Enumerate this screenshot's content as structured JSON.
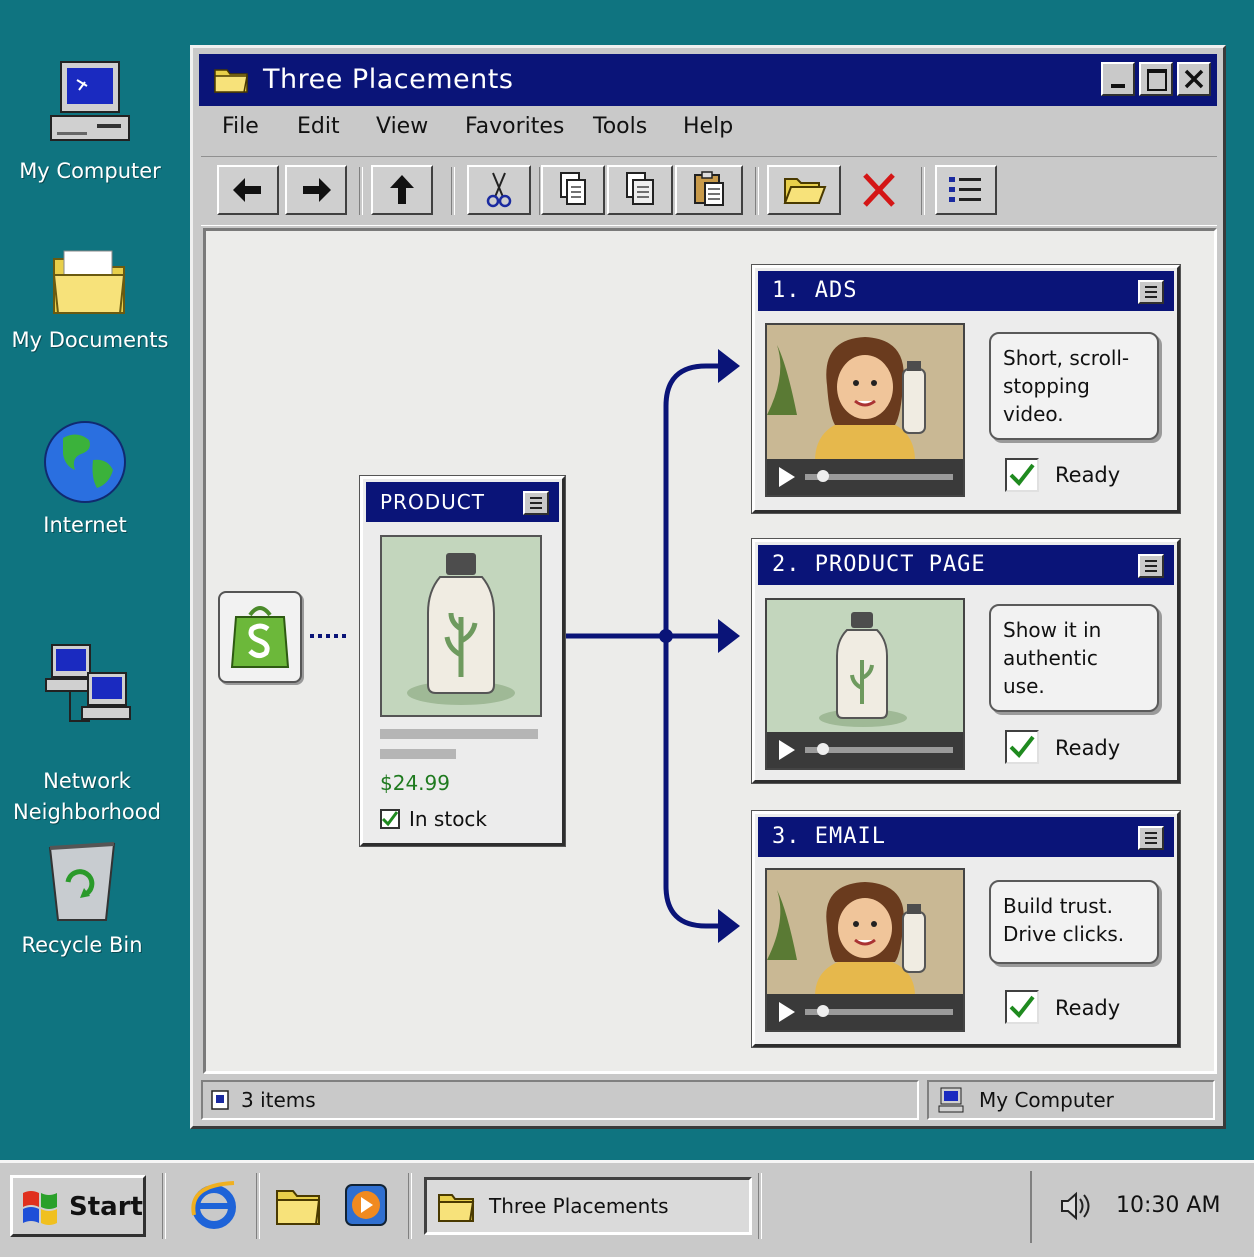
{
  "desktop": {
    "icons": [
      {
        "label": "My Computer"
      },
      {
        "label": "My Documents"
      },
      {
        "label": "Internet"
      },
      {
        "label": "Network\nNeighborhood"
      },
      {
        "label": "Recycle Bin"
      }
    ]
  },
  "window": {
    "title": "Three Placements",
    "menu": [
      "File",
      "Edit",
      "View",
      "Favorites",
      "Tools",
      "Help"
    ],
    "toolbar": [
      "back-icon",
      "forward-icon",
      "up-icon",
      "cut-icon",
      "copy-icon",
      "copy-to-icon",
      "paste-icon",
      "open-folder-icon",
      "delete-icon",
      "details-view-icon"
    ]
  },
  "product": {
    "header": "PRODUCT",
    "price": "$24.99",
    "stock": "In stock",
    "in_stock": true
  },
  "placements": [
    {
      "title": "1. ADS",
      "caption": "Short, scroll-stopping video.",
      "status": "Ready",
      "checked": true
    },
    {
      "title": "2. PRODUCT PAGE",
      "caption": "Show it in authentic use.",
      "status": "Ready",
      "checked": true
    },
    {
      "title": "3. EMAIL",
      "caption": "Build trust. Drive clicks.",
      "status": "Ready",
      "checked": true
    }
  ],
  "statusbar": {
    "items": "3 items",
    "location": "My Computer"
  },
  "taskbar": {
    "start": "Start",
    "task": "Three Placements",
    "time": "10:30 AM"
  },
  "colors": {
    "desktop": "#0f7480",
    "titlebar": "#0a1478",
    "price": "#1f7a1f",
    "accent_green": "#2e9e2e"
  }
}
